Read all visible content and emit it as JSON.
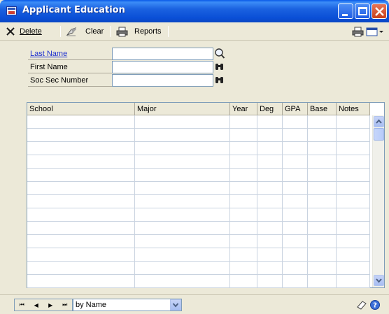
{
  "window": {
    "title": "Applicant Education"
  },
  "toolbar": {
    "delete_label": "Delete",
    "clear_label": "Clear",
    "reports_label": "Reports"
  },
  "form": {
    "last_name": {
      "label": "Last Name",
      "value": ""
    },
    "first_name": {
      "label": "First Name",
      "value": ""
    },
    "ssn": {
      "label": "Soc Sec Number",
      "value": ""
    }
  },
  "grid": {
    "columns": [
      "School",
      "Major",
      "Year",
      "Deg",
      "GPA",
      "Base",
      "Notes"
    ],
    "row_count": 13
  },
  "statusbar": {
    "sort_value": "by Name"
  },
  "colors": {
    "title_blue": "#0a4fd6",
    "link_blue": "#1c2fd0",
    "window_bg": "#ece9d8"
  }
}
